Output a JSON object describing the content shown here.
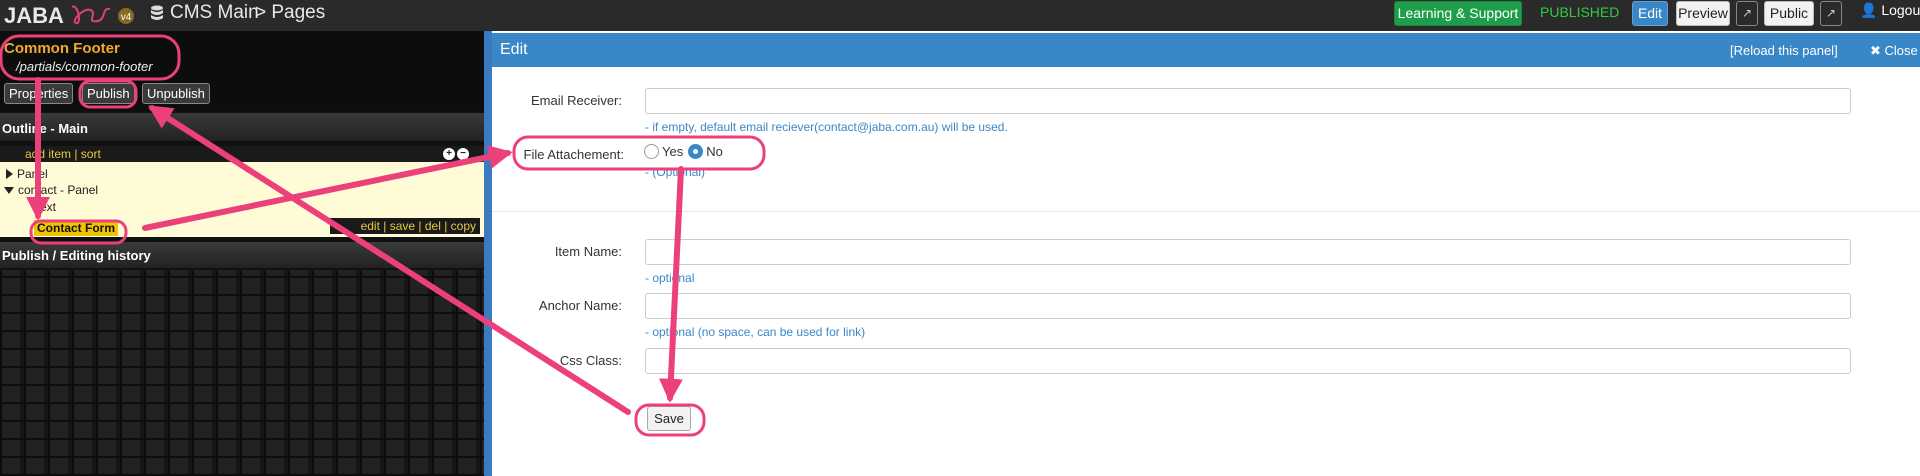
{
  "topbar": {
    "logo_text": "JABA",
    "logo_version": "v4",
    "cms_title": "CMS Main",
    "breadcrumb": "> Pages",
    "learn_label": "Learning & Support",
    "status": "PUBLISHED",
    "edit_label": "Edit",
    "preview_label": "Preview",
    "public_label": "Public",
    "logout_label": "Logout",
    "colors": {
      "bar": "#2a2a2a",
      "green": "#1e9e4a",
      "blue": "#3a87c8"
    }
  },
  "page": {
    "name": "Common Footer",
    "path": "/partials/common-footer",
    "buttons": {
      "properties": "Properties",
      "publish": "Publish",
      "unpublish": "Unpublish"
    }
  },
  "outline": {
    "title": "Outline - Main",
    "add_sort": "add item | sort",
    "tree": [
      {
        "label": "Panel",
        "expanded": false
      },
      {
        "label": "contact - Panel",
        "expanded": true
      },
      {
        "label": "Text"
      },
      {
        "label": "Contact Form",
        "selected": true
      }
    ],
    "row_actions": "edit | save | del | copy"
  },
  "history": {
    "title": "Publish / Editing history"
  },
  "edit": {
    "title": "Edit",
    "reload": "[Reload this panel]",
    "close": "Close",
    "fields": {
      "email_label": "Email Receiver:",
      "email_hint": "- if empty, default email reciever(contact@jaba.com.au) will be used.",
      "attach_label": "File Attachement:",
      "attach_yes": "Yes",
      "attach_no": "No",
      "attach_selected": "No",
      "attach_hint": "- (Optional)",
      "item_label": "Item Name:",
      "item_hint": "- optional",
      "anchor_label": "Anchor Name:",
      "anchor_hint": "- optional (no space, can be used for link)",
      "css_label": "Css Class:"
    },
    "save_label": "Save"
  },
  "annotation_color": "#ec407a"
}
